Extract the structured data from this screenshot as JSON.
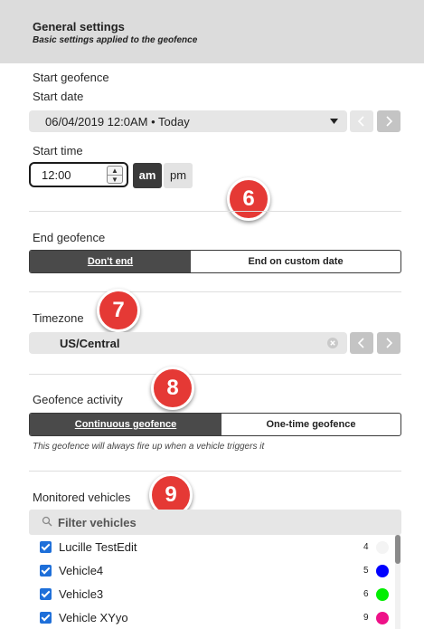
{
  "header": {
    "title": "General settings",
    "subtitle": "Basic settings applied to the geofence"
  },
  "start": {
    "section_label": "Start geofence",
    "date_label": "Start date",
    "date_value": "06/04/2019 12:0AM • Today",
    "time_label": "Start time",
    "time_value": "12:00",
    "am_label": "am",
    "pm_label": "pm",
    "selected_meridiem": "am"
  },
  "end": {
    "label": "End geofence",
    "options": [
      "Don't end",
      "End on custom date"
    ],
    "selected": "Don't end"
  },
  "timezone": {
    "label": "Timezone",
    "value": "US/Central"
  },
  "activity": {
    "label": "Geofence activity",
    "options": [
      "Continuous geofence",
      "One-time geofence"
    ],
    "selected": "Continuous geofence",
    "hint": "This geofence will always fire up when a vehicle triggers it"
  },
  "vehicles": {
    "label": "Monitored vehicles",
    "filter_placeholder": "Filter vehicles",
    "items": [
      {
        "name": "Lucille TestEdit",
        "count": "4",
        "checked": true,
        "color": "#f4f4f4"
      },
      {
        "name": "Vehicle4",
        "count": "5",
        "checked": true,
        "color": "#0000ff"
      },
      {
        "name": "Vehicle3",
        "count": "6",
        "checked": true,
        "color": "#00ee00"
      },
      {
        "name": "Vehicle XYyo",
        "count": "9",
        "checked": true,
        "color": "#ee1188"
      }
    ]
  },
  "annotations": {
    "badge_6": "6",
    "badge_7": "7",
    "badge_8": "8",
    "badge_9": "9"
  },
  "colors": {
    "accent": "#1e6fd9",
    "badge": "#e53935",
    "dark_toggle": "#3a3a3a"
  },
  "icons": {
    "dropdown": "caret-down-icon",
    "prev": "chevron-left-icon",
    "next": "chevron-right-icon",
    "clear": "clear-icon",
    "search": "search-icon",
    "checkbox": "checkbox-checked-icon"
  }
}
